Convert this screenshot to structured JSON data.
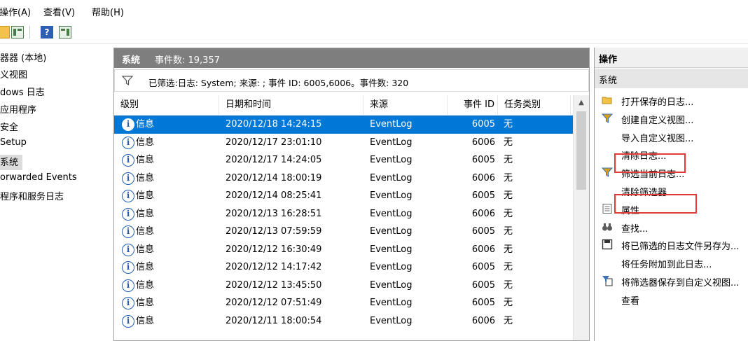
{
  "menu": [
    "操作(A)",
    "查看(V)",
    "帮助(H)"
  ],
  "tree": [
    "器器 (本地)",
    "义视图",
    "dows 日志",
    "应用程序",
    "安全",
    "Setup",
    "系统",
    "orwarded Events",
    "程序和服务日志"
  ],
  "center": {
    "log_name": "系统",
    "event_count": "事件数: 19,357",
    "filter_text": "已筛选:日志: System; 来源: ; 事件 ID: 6005,6006。事件数: 320",
    "columns": [
      "级别",
      "日期和时间",
      "来源",
      "事件 ID",
      "任务类别"
    ],
    "rows": [
      {
        "level": "信息",
        "datetime": "2020/12/18 14:24:15",
        "source": "EventLog",
        "id": "6005",
        "task": "无"
      },
      {
        "level": "信息",
        "datetime": "2020/12/17 23:01:10",
        "source": "EventLog",
        "id": "6006",
        "task": "无"
      },
      {
        "level": "信息",
        "datetime": "2020/12/17 14:24:05",
        "source": "EventLog",
        "id": "6005",
        "task": "无"
      },
      {
        "level": "信息",
        "datetime": "2020/12/14 18:00:19",
        "source": "EventLog",
        "id": "6006",
        "task": "无"
      },
      {
        "level": "信息",
        "datetime": "2020/12/14 08:25:41",
        "source": "EventLog",
        "id": "6005",
        "task": "无"
      },
      {
        "level": "信息",
        "datetime": "2020/12/13 16:28:51",
        "source": "EventLog",
        "id": "6006",
        "task": "无"
      },
      {
        "level": "信息",
        "datetime": "2020/12/13 07:59:59",
        "source": "EventLog",
        "id": "6005",
        "task": "无"
      },
      {
        "level": "信息",
        "datetime": "2020/12/12 16:30:49",
        "source": "EventLog",
        "id": "6006",
        "task": "无"
      },
      {
        "level": "信息",
        "datetime": "2020/12/12 14:17:42",
        "source": "EventLog",
        "id": "6005",
        "task": "无"
      },
      {
        "level": "信息",
        "datetime": "2020/12/12 13:45:50",
        "source": "EventLog",
        "id": "6005",
        "task": "无"
      },
      {
        "level": "信息",
        "datetime": "2020/12/12 07:51:49",
        "source": "EventLog",
        "id": "6005",
        "task": "无"
      },
      {
        "level": "信息",
        "datetime": "2020/12/11 18:00:54",
        "source": "EventLog",
        "id": "6006",
        "task": "无"
      }
    ]
  },
  "actions": {
    "header": "操作",
    "section": "系统",
    "items": [
      {
        "label": "打开保存的日志...",
        "icon": "folder-open-icon"
      },
      {
        "label": "创建自定义视图...",
        "icon": "filter-funnel-icon"
      },
      {
        "label": "导入自定义视图...",
        "icon": ""
      },
      {
        "label": "清除日志...",
        "icon": ""
      },
      {
        "label": "筛选当前日志...",
        "icon": "filter-funnel-icon"
      },
      {
        "label": "清除筛选器",
        "icon": ""
      },
      {
        "label": "属性",
        "icon": "properties-icon"
      },
      {
        "label": "查找...",
        "icon": "binoculars-icon"
      },
      {
        "label": "将已筛选的日志文件另存为...",
        "icon": "save-icon"
      },
      {
        "label": "将任务附加到此日志...",
        "icon": ""
      },
      {
        "label": "将筛选器保存到自定义视图...",
        "icon": "save-filter-icon"
      },
      {
        "label": "查看",
        "icon": ""
      }
    ]
  },
  "colors": {
    "selection": "#0078d7",
    "header_gray": "#7e7e7e",
    "highlight_box": "#e53935"
  }
}
